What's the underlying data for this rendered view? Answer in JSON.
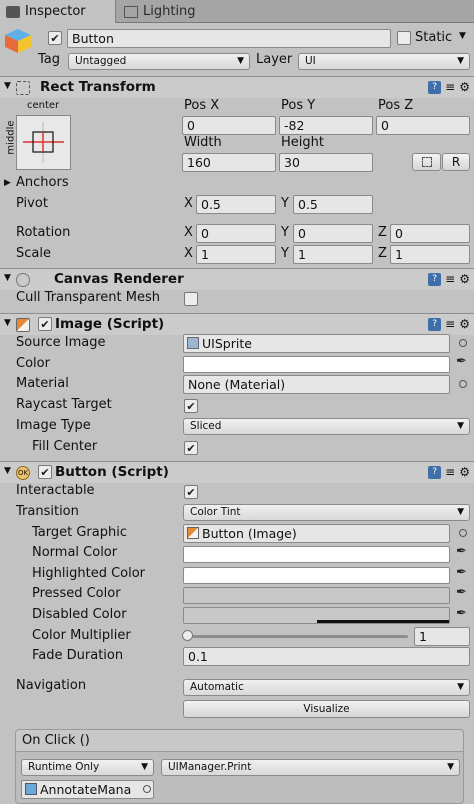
{
  "tabs": {
    "inspector": "Inspector",
    "lighting": "Lighting"
  },
  "header": {
    "name_value": "Button",
    "static_label": "Static",
    "tag_label": "Tag",
    "tag_value": "Untagged",
    "layer_label": "Layer",
    "layer_value": "UI"
  },
  "rect_transform": {
    "title": "Rect Transform",
    "anchor_top": "center",
    "anchor_side": "middle",
    "pos_x_label": "Pos X",
    "pos_y_label": "Pos Y",
    "pos_z_label": "Pos Z",
    "pos_x": "0",
    "pos_y": "-82",
    "pos_z": "0",
    "width_label": "Width",
    "height_label": "Height",
    "width": "160",
    "height": "30",
    "raw_label": "R",
    "anchors_label": "Anchors",
    "pivot_label": "Pivot",
    "pivot_x": "0.5",
    "pivot_y": "0.5",
    "rotation_label": "Rotation",
    "rot_x": "0",
    "rot_y": "0",
    "rot_z": "0",
    "scale_label": "Scale",
    "scale_x": "1",
    "scale_y": "1",
    "scale_z": "1",
    "axis_x": "X",
    "axis_y": "Y",
    "axis_z": "Z"
  },
  "canvas_renderer": {
    "title": "Canvas Renderer",
    "cull_label": "Cull Transparent Mesh"
  },
  "image": {
    "title": "Image (Script)",
    "source_label": "Source Image",
    "source_value": "UISprite",
    "color_label": "Color",
    "material_label": "Material",
    "material_value": "None (Material)",
    "raycast_label": "Raycast Target",
    "type_label": "Image Type",
    "type_value": "Sliced",
    "fill_label": "Fill Center"
  },
  "button": {
    "title": "Button (Script)",
    "interactable_label": "Interactable",
    "transition_label": "Transition",
    "transition_value": "Color Tint",
    "target_label": "Target Graphic",
    "target_value": "Button (Image)",
    "normal_label": "Normal Color",
    "highlighted_label": "Highlighted Color",
    "pressed_label": "Pressed Color",
    "disabled_label": "Disabled Color",
    "multiplier_label": "Color Multiplier",
    "multiplier_value": "1",
    "fade_label": "Fade Duration",
    "fade_value": "0.1",
    "navigation_label": "Navigation",
    "navigation_value": "Automatic",
    "visualize_label": "Visualize"
  },
  "onclick": {
    "title": "On Click ()",
    "runtime_value": "Runtime Only",
    "function_value": "UIManager.Print",
    "object_value": "AnnotateMana"
  },
  "colors": {
    "pressed": "#c8c8c8",
    "disabled": "#c8c8c8",
    "accent": "#3f6fa8"
  }
}
